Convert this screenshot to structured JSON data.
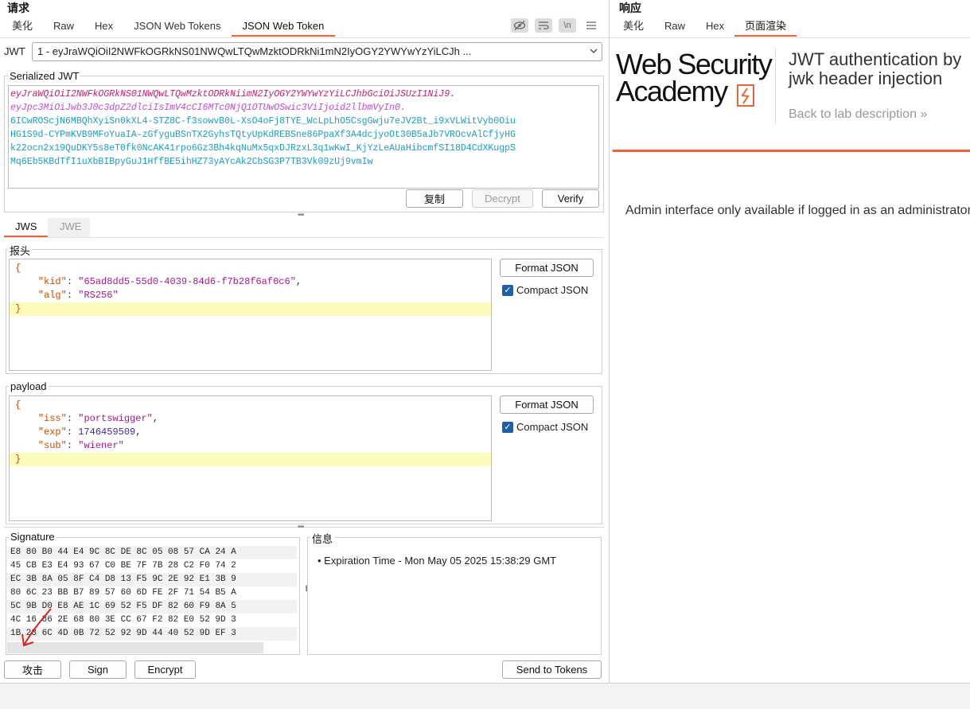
{
  "request": {
    "title": "请求",
    "tabs": [
      "美化",
      "Raw",
      "Hex",
      "JSON Web Tokens",
      "JSON Web Token"
    ],
    "active_tab": "JSON Web Token",
    "jwt_label": "JWT",
    "jwt_select_value": "1 - eyJraWQiOiI2NWFkOGRkNS01NWQwLTQwMzktODRkNi1mN2IyOGY2YWYwYzYiLCJh ...",
    "serialized_label": "Serialized JWT",
    "serialized_header": "eyJraWQiOiI2NWFkOGRkNS01NWQwLTQwMzktODRkNiimN2IyOGY2YWYwYzYiLCJhbGciOiJSUzI1NiJ9.",
    "serialized_payload": "eyJpc3MiOiJwb3J0c3dpZ2dlciIsImV4cCI6MTc0NjQ1OTUwOSwic3ViIjoid2llbmVyIn0.",
    "serialized_signature_lines": [
      "6ICwROScjN6MBQhXyiSn0kXL4-STZ8C-f3sowvB0L-XsO4oFj8TYE_WcLpLhO5CsgGwju7eJV2Bt_i9xVLWitVyb0Oiu",
      "HG1S9d-CYPmKVB9MFoYuaIA-zGfyguBSnTX2GyhsTQtyUpKdREBSne86PpaXf3A4dcjyoOt30B5aJb7VROcvAlCfjyHG",
      "k22ocn2x19QuDKY5s8eT0fk0NcAK41rpo6Gz3Bh4kqNuMx5qxDJRzxL3q1wKwI_KjYzLeAUaHibcmfSI18D4CdXKugpS",
      "Mq6Eb5KBdTfI1uXbBIBpyGuJ1HffBE5ihHZ73yAYcAk2CbSG3P7TB3Vk09zUj9vmIw"
    ],
    "copy_button": "复制",
    "decrypt_button": "Decrypt",
    "verify_button": "Verify",
    "jws_tabs": [
      "JWS",
      "JWE"
    ],
    "header_label": "报头",
    "header_json": {
      "kid": "65ad8dd5-55d0-4039-84d6-f7b28f6af0c6",
      "alg": "RS256"
    },
    "payload_label": "payload",
    "payload_json": {
      "iss": "portswigger",
      "exp": "1746459509",
      "sub": "wiener"
    },
    "format_json_button": "Format JSON",
    "compact_json_label": "Compact JSON",
    "compact_json_checked": true,
    "signature_label": "Signature",
    "signature_hex_lines": [
      "E8 80 B0 44 E4 9C 8C DE 8C 05 08 57 CA 24 A",
      "45 CB E3 E4 93 67 C0 BE 7F 7B 28 C2 F0 74 2",
      "EC 3B 8A 05 8F C4 D8 13 F5 9C 2E 92 E1 3B 9",
      "80 6C 23 BB B7 89 57 60 6D FE 2F 71 54 B5 A",
      "5C 9B D0 E8 AE 1C 69 52 F5 DF 82 60 F9 8A 5",
      "4C 16 86 2E 68 80 3E CC 67 F2 82 E0 52 9D 3",
      "1B 28 6C 4D 0B 72 52 92 9D 44 40 52 9D EF 3"
    ],
    "info_label": "信息",
    "info_items": [
      "Expiration Time - Mon May 05 2025 15:38:29 GMT"
    ],
    "attack_button": "攻击",
    "sign_button": "Sign",
    "encrypt_button": "Encrypt",
    "send_to_tokens_button": "Send to Tokens"
  },
  "response": {
    "title": "响应",
    "tabs": [
      "美化",
      "Raw",
      "Hex",
      "页面渲染"
    ],
    "active_tab": "页面渲染",
    "logo_line1": "Web Security",
    "logo_line2": "Academy",
    "lab_title": "JWT authentication by jwk header injection",
    "back_link": "Back to lab description",
    "message": "Admin interface only available if logged in as an administrator"
  },
  "colors": {
    "accent": "#e8643a",
    "checkbox": "#1f5fa8"
  }
}
